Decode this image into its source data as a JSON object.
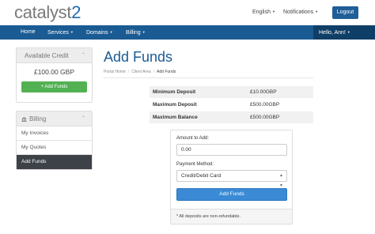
{
  "brand": {
    "logo_text": "catalyst",
    "logo_number": "2",
    "logo_main_color": "#7a7a7a",
    "logo_accent_color": "#1f6bb5"
  },
  "top_nav": {
    "language": "English",
    "notifications": "Notifications",
    "logout": "Logout",
    "caret_icon": "caret-down-icon"
  },
  "main_nav": {
    "items": [
      "Home",
      "Services",
      "Domains",
      "Billing"
    ],
    "user_menu": "Hello, Ann!",
    "bar_color": "#1a5b93"
  },
  "sidebar": {
    "credit_panel": {
      "title": "Available Credit",
      "amount": "£100.00 GBP",
      "button": "+ Add Funds",
      "button_color": "#52b152"
    },
    "billing_panel": {
      "title": "Billing",
      "icon": "bank-icon",
      "items": [
        "My Invoices",
        "My Quotes",
        "Add Funds"
      ],
      "active_index": 2
    }
  },
  "main": {
    "title": "Add Funds",
    "breadcrumb": [
      "Portal Home",
      "Client Area",
      "Add Funds"
    ],
    "limits": [
      {
        "label": "Minimum Deposit",
        "value": "£10.00GBP"
      },
      {
        "label": "Maximum Deposit",
        "value": "£500.00GBP"
      },
      {
        "label": "Maximum Balance",
        "value": "£500.00GBP"
      }
    ],
    "form": {
      "amount_label": "Amount to Add:",
      "amount_value": "0.00",
      "method_label": "Payment Method:",
      "method_value": "Credit/Debit Card",
      "submit_label": "Add Funds",
      "footnote": "* All deposits are non-refundable."
    }
  }
}
